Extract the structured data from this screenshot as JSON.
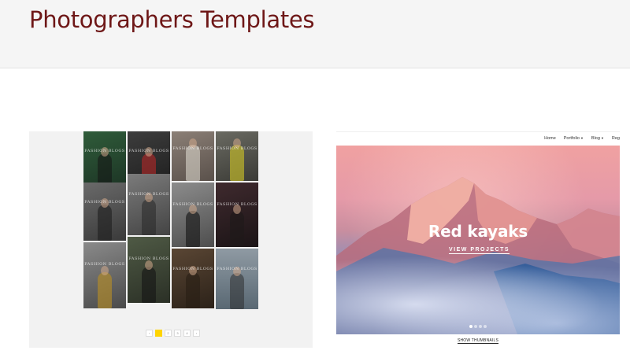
{
  "page": {
    "title": "Photographers Templates"
  },
  "left_template": {
    "cell_caption": "FASHION BLOGS",
    "pager": [
      "‹",
      "",
      "2",
      "3",
      "4",
      "›"
    ],
    "pager_active_index": 1
  },
  "right_template": {
    "nav": [
      {
        "label": "Home",
        "dropdown": false
      },
      {
        "label": "Portfolio",
        "dropdown": true
      },
      {
        "label": "Blog",
        "dropdown": true
      },
      {
        "label": "Reg",
        "dropdown": false
      }
    ],
    "hero_title": "Red kayaks",
    "hero_link": "VIEW PROJECTS",
    "slider_dots": 4,
    "slider_active": 0,
    "show_thumbnails": "SHOW THUMBNAILS"
  }
}
